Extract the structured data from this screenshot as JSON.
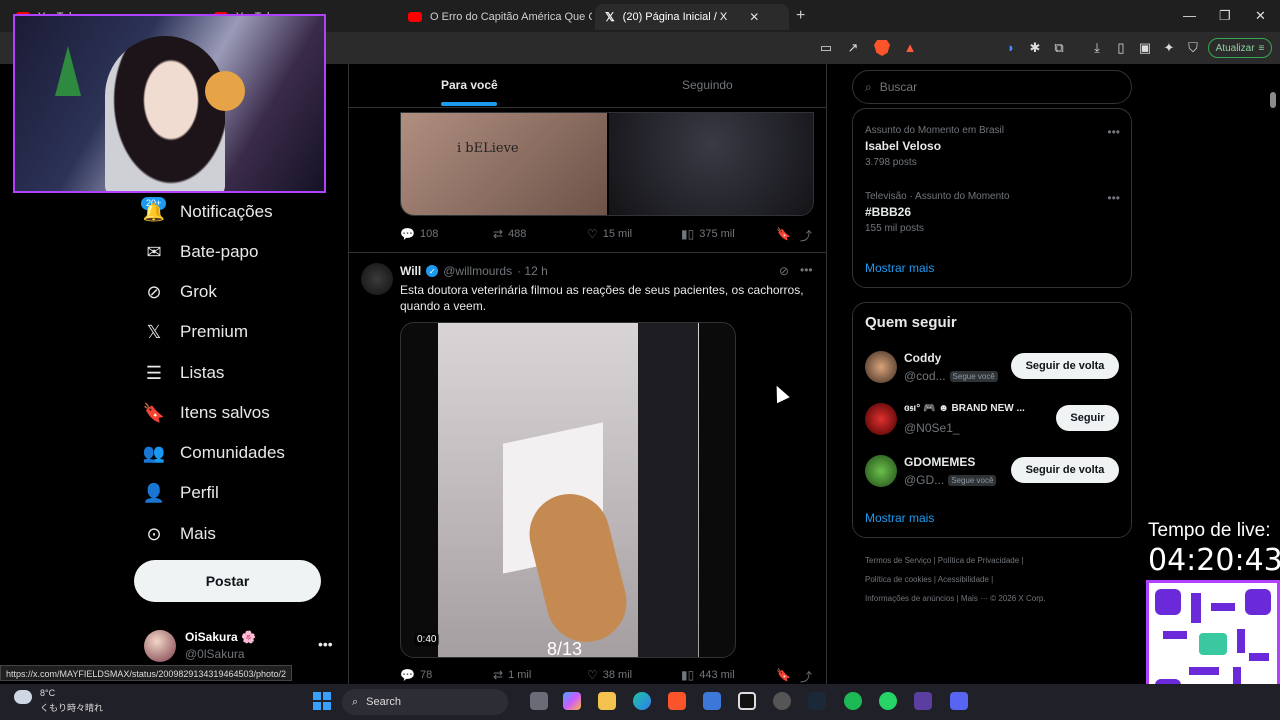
{
  "browser": {
    "tabs": [
      {
        "label": "YouTube"
      },
      {
        "label": "YouTube"
      },
      {
        "label": "O Erro do Capitão América Que Cri..."
      },
      {
        "label": "(20) Página Inicial / X"
      }
    ],
    "update_label": "Atualizar",
    "status_url": "https://x.com/MAYFIELDSMAX/status/2009829134319464503/photo/2"
  },
  "sidebar": {
    "notifications_badge": "20+",
    "items": [
      {
        "label": "Notificações",
        "icon": "bell-icon"
      },
      {
        "label": "Bate-papo",
        "icon": "mail-icon"
      },
      {
        "label": "Grok",
        "icon": "grok-icon"
      },
      {
        "label": "Premium",
        "icon": "x-logo-icon"
      },
      {
        "label": "Listas",
        "icon": "list-icon"
      },
      {
        "label": "Itens salvos",
        "icon": "bookmark-icon"
      },
      {
        "label": "Comunidades",
        "icon": "people-icon"
      },
      {
        "label": "Perfil",
        "icon": "user-icon"
      },
      {
        "label": "Mais",
        "icon": "more-circle-icon"
      }
    ],
    "post_label": "Postar",
    "account": {
      "name": "OiSakura 🌸",
      "handle": "@0lSakura"
    }
  },
  "feed": {
    "tabs": {
      "for_you": "Para você",
      "following": "Seguindo"
    },
    "tweet1": {
      "wrist_text": "i bELieve",
      "replies": "108",
      "reposts": "488",
      "likes": "15 mil",
      "views": "375 mil"
    },
    "tweet2": {
      "name": "Will",
      "handle": "@willmourds",
      "time": "· 12 h",
      "text": "Esta doutora veterinária filmou as reações de seus pacientes, os cachorros, quando a veem.",
      "video_duration": "0:40",
      "video_counter": "8/13",
      "replies": "78",
      "reposts": "1 mil",
      "likes": "38 mil",
      "views": "443 mil"
    }
  },
  "right": {
    "search_placeholder": "Buscar",
    "trends": [
      {
        "context": "Assunto do Momento em Brasil",
        "title": "Isabel Veloso",
        "count": "3.798 posts"
      },
      {
        "context": "Televisão · Assunto do Momento",
        "title": "#BBB26",
        "count": "155 mil posts"
      }
    ],
    "show_more": "Mostrar mais",
    "who_to_follow": {
      "title": "Quem seguir",
      "users": [
        {
          "name": "Coddy",
          "handle": "@cod...",
          "follows_you": "Segue você",
          "button": "Seguir de volta"
        },
        {
          "name": "ɞ𝔰ı° 🎮 ☻ BRAND NEW ...",
          "handle": "@N0Se1_",
          "follows_you": "",
          "button": "Seguir"
        },
        {
          "name": "GDOMEMES",
          "handle": "@GD...",
          "follows_you": "Segue você",
          "button": "Seguir de volta"
        }
      ],
      "show_more": "Mostrar mais"
    },
    "footer": {
      "line1a": "Termos de Serviço",
      "line1b": "Política de Privacidade",
      "line2a": "Política de cookies",
      "line2b": "Acessibilidade",
      "line3a": "Informações de anúncios",
      "line3b": "Mais ···",
      "line3c": "© 2026 X Corp."
    }
  },
  "overlay": {
    "live_label": "Tempo de live:",
    "live_timer": "04:20:43"
  },
  "taskbar": {
    "temp": "8°C",
    "weather": "くもり時々晴れ",
    "search_label": "Search"
  },
  "colors": {
    "accent": "#1d9bf0",
    "stream_border": "#b042ff"
  }
}
